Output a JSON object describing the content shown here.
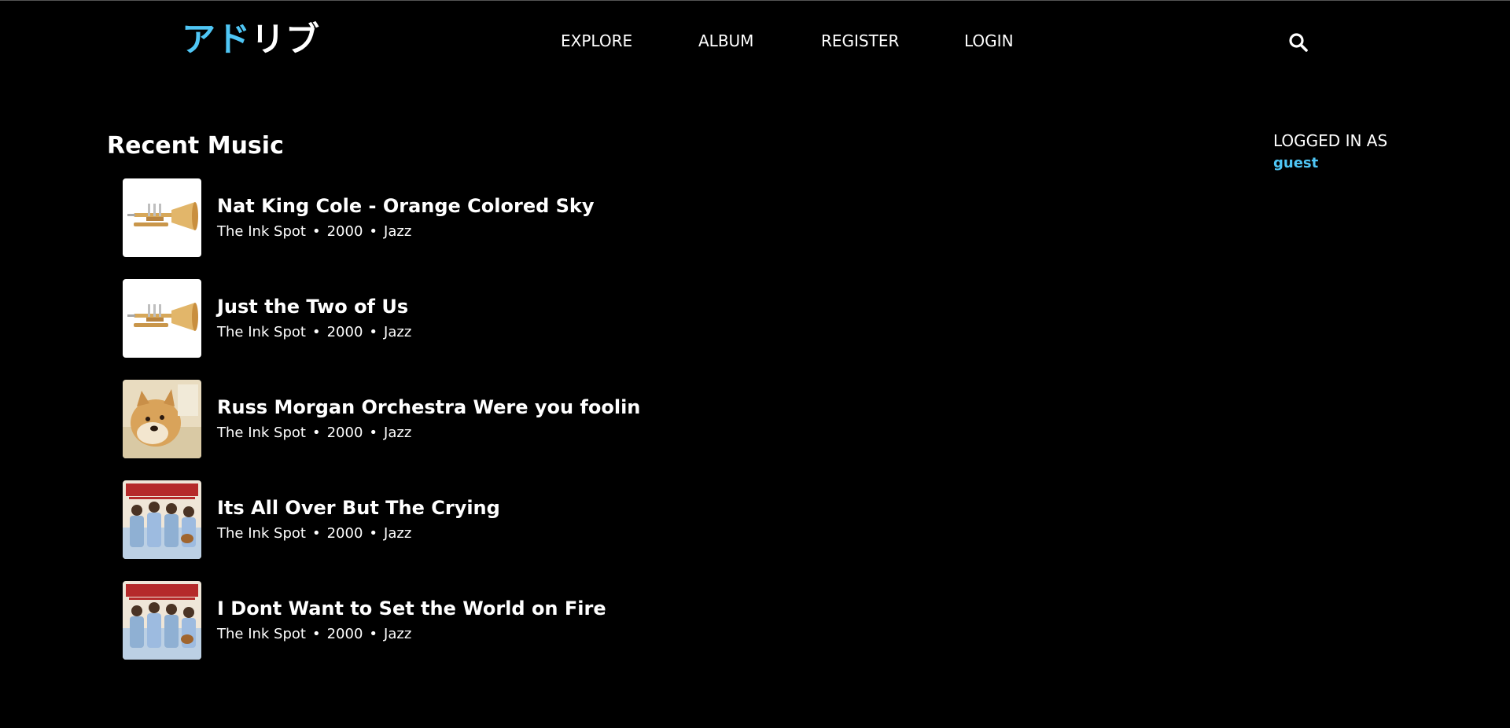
{
  "header": {
    "logo_accent": "アド",
    "logo_rest": "リブ",
    "nav": [
      "EXPLORE",
      "ALBUM",
      "REGISTER",
      "LOGIN"
    ],
    "search_icon": "search-icon"
  },
  "main": {
    "section_title": "Recent Music",
    "tracks": [
      {
        "title": "Nat King Cole - Orange Colored Sky",
        "artist": "The Ink Spot",
        "year": "2000",
        "genre": "Jazz",
        "cover": "trumpet"
      },
      {
        "title": "Just the Two of Us",
        "artist": "The Ink Spot",
        "year": "2000",
        "genre": "Jazz",
        "cover": "trumpet"
      },
      {
        "title": "Russ Morgan Orchestra Were you foolin",
        "artist": "The Ink Spot",
        "year": "2000",
        "genre": "Jazz",
        "cover": "doge"
      },
      {
        "title": "Its All Over But The Crying",
        "artist": "The Ink Spot",
        "year": "2000",
        "genre": "Jazz",
        "cover": "ink-spots"
      },
      {
        "title": "I Dont Want to Set the World on Fire",
        "artist": "The Ink Spot",
        "year": "2000",
        "genre": "Jazz",
        "cover": "ink-spots"
      }
    ],
    "separator": "•"
  },
  "sidebar": {
    "label": "LOGGED IN AS",
    "user": "guest"
  },
  "colors": {
    "background": "#000000",
    "accent": "#4fc6f5",
    "text": "#ffffff"
  }
}
